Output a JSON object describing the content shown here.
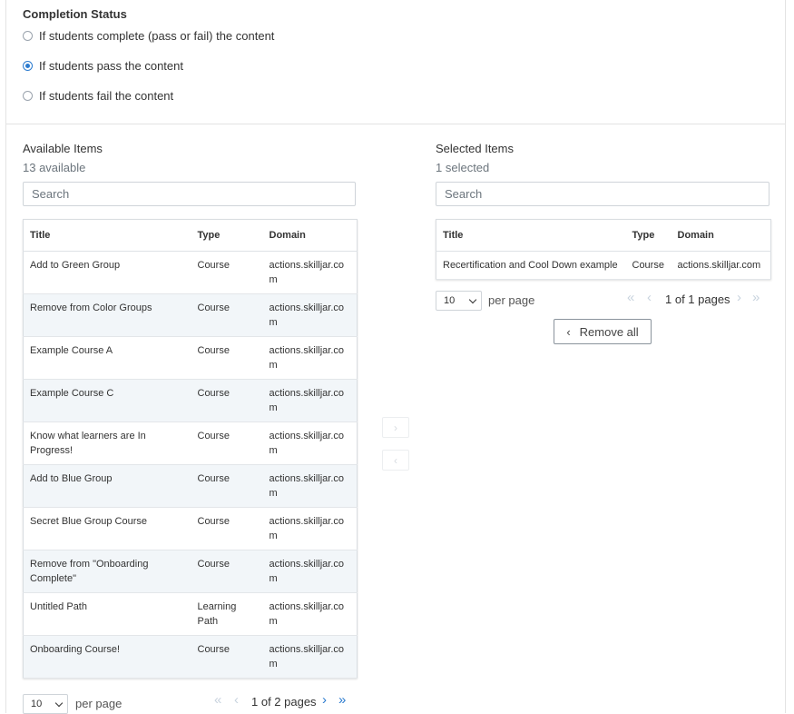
{
  "completion_status": {
    "title": "Completion Status",
    "options": [
      {
        "label": "If students complete (pass or fail) the content",
        "checked": false
      },
      {
        "label": "If students pass the content",
        "checked": true
      },
      {
        "label": "If students fail the content",
        "checked": false
      }
    ]
  },
  "available": {
    "title": "Available Items",
    "count": "13 available",
    "search_placeholder": "Search",
    "columns": [
      "Title",
      "Type",
      "Domain"
    ],
    "rows": [
      {
        "title": "Add to Green Group",
        "type": "Course",
        "domain": "actions.skilljar.com"
      },
      {
        "title": "Remove from Color Groups",
        "type": "Course",
        "domain": "actions.skilljar.com"
      },
      {
        "title": "Example Course A",
        "type": "Course",
        "domain": "actions.skilljar.com"
      },
      {
        "title": "Example Course C",
        "type": "Course",
        "domain": "actions.skilljar.com"
      },
      {
        "title": "Know what learners are In Progress!",
        "type": "Course",
        "domain": "actions.skilljar.com"
      },
      {
        "title": "Add to Blue Group",
        "type": "Course",
        "domain": "actions.skilljar.com"
      },
      {
        "title": "Secret Blue Group Course",
        "type": "Course",
        "domain": "actions.skilljar.com"
      },
      {
        "title": "Remove from \"Onboarding Complete\"",
        "type": "Course",
        "domain": "actions.skilljar.com"
      },
      {
        "title": "Untitled Path",
        "type": "Learning Path",
        "domain": "actions.skilljar.com"
      },
      {
        "title": "Onboarding Course!",
        "type": "Course",
        "domain": "actions.skilljar.com"
      }
    ],
    "per_page_value": "10",
    "per_page_label": "per page",
    "page_info": "1 of 2 pages",
    "pager": {
      "first": "«",
      "prev": "‹",
      "next": "›",
      "last": "»"
    }
  },
  "selected": {
    "title": "Selected Items",
    "count": "1 selected",
    "search_placeholder": "Search",
    "columns": [
      "Title",
      "Type",
      "Domain"
    ],
    "rows": [
      {
        "title": "Recertification and Cool Down example",
        "type": "Course",
        "domain": "actions.skilljar.com"
      }
    ],
    "per_page_value": "10",
    "per_page_label": "per page",
    "page_info": "1 of 1 pages",
    "pager": {
      "first": "«",
      "prev": "‹",
      "next": "›",
      "last": "»"
    },
    "remove_all_label": "Remove all"
  },
  "move": {
    "add_glyph": "›",
    "remove_glyph": "‹"
  },
  "colors": {
    "accent": "#2b7bcf",
    "row_alt": "#f2f6f9",
    "border": "#d9dde1"
  }
}
